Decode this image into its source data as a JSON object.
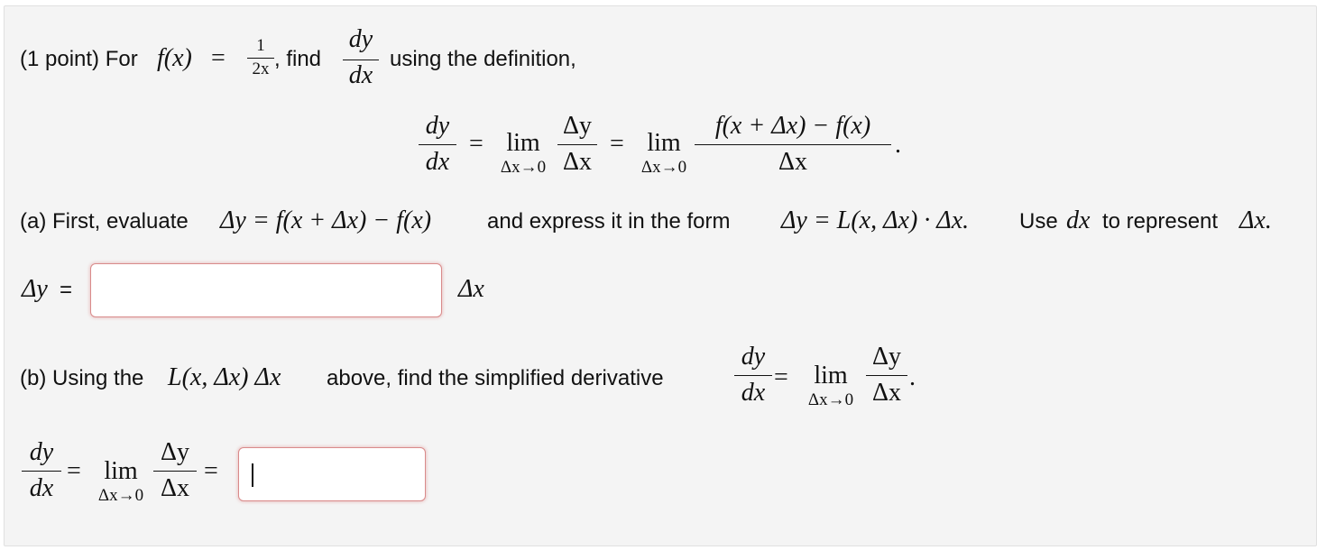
{
  "intro": {
    "prefix": "(1 point) For",
    "f_lhs": "f(x)",
    "eq": "=",
    "f_num": "1",
    "f_den": "2x",
    "comma_find": ", find",
    "dy": "dy",
    "dx": "dx",
    "suffix": "using the definition,"
  },
  "definition": {
    "dy": "dy",
    "dx": "dx",
    "eq1": "=",
    "lim": "lim",
    "lim_sub": "Δx→0",
    "delta_y": "Δy",
    "delta_x": "Δx",
    "eq2": "=",
    "lim2": "lim",
    "lim2_sub": "Δx→0",
    "diff_num": "f(x + Δx) − f(x)",
    "diff_den": "Δx",
    "period": "."
  },
  "part_a": {
    "t1": "(a) First, evaluate",
    "m1": "Δy = f(x + Δx) − f(x)",
    "t2": "and express it in the form",
    "m2": "Δy = L(x, Δx) · Δx.",
    "t3": "Use",
    "m3": "dx",
    "t4": "to represent",
    "m4": "Δx.",
    "answer_lhs_var": "Δy",
    "answer_lhs_eq": "=",
    "answer_value": "",
    "answer_suffix": "Δx"
  },
  "part_b": {
    "t1": "(b) Using the",
    "m1": "L(x, Δx) Δx",
    "t2": "above, find the simplified derivative",
    "dy": "dy",
    "dx": "dx",
    "eq": "=",
    "lim": "lim",
    "lim_sub": "Δx→0",
    "delta_y": "Δy",
    "delta_x": "Δx",
    "period": ".",
    "ans_dy": "dy",
    "ans_dx": "dx",
    "ans_eq1": "=",
    "ans_lim": "lim",
    "ans_lim_sub": "Δx→0",
    "ans_delta_y": "Δy",
    "ans_delta_x": "Δx",
    "ans_eq2": "=",
    "answer_value": ""
  },
  "colors": {
    "panel_bg": "#f4f4f4",
    "input_border": "#d98a8a"
  }
}
